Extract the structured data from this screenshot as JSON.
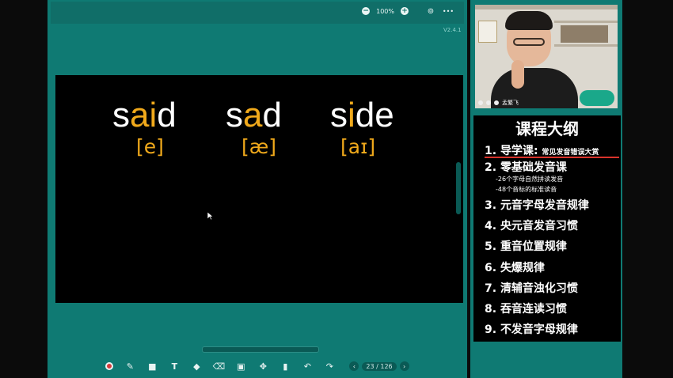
{
  "topbar": {
    "zoom": "100%",
    "zoom_out": "−",
    "zoom_in": "+",
    "settings_glyph": "⊚",
    "more_glyph": "•••"
  },
  "version": "V2.4.1",
  "slide": {
    "words": [
      {
        "pre": "s",
        "hl": "ai",
        "post": "d",
        "ipa": "[e]"
      },
      {
        "pre": "s",
        "hl": "a",
        "post": "d",
        "ipa": "[æ]"
      },
      {
        "pre": "s",
        "hl": "i",
        "post": "de",
        "ipa": "[aɪ]"
      }
    ],
    "highlight_color": "#f0a91b"
  },
  "toolbar": {
    "tools": [
      {
        "name": "record-icon"
      },
      {
        "name": "pen-icon",
        "glyph": "✎"
      },
      {
        "name": "rectangle-icon",
        "glyph": "■"
      },
      {
        "name": "text-icon",
        "glyph": "T"
      },
      {
        "name": "bucket-icon",
        "glyph": "◆"
      },
      {
        "name": "eraser-icon",
        "glyph": "⌫"
      },
      {
        "name": "save-icon",
        "glyph": "▣"
      },
      {
        "name": "move-icon",
        "glyph": "✥"
      },
      {
        "name": "trash-icon",
        "glyph": "▮"
      },
      {
        "name": "undo-icon",
        "glyph": "↶"
      },
      {
        "name": "redo-icon",
        "glyph": "↷"
      }
    ],
    "page_current": "23",
    "page_total": "/ 126",
    "prev": "‹",
    "next": "›"
  },
  "video": {
    "name": "孟繁飞"
  },
  "outline": {
    "title": "课程大纲",
    "items": [
      {
        "num": "1.",
        "label": "导学课",
        "colon": ":",
        "sub": "常见发音错误大赏",
        "color": "#f0a91b"
      },
      {
        "num": "2.",
        "label": "零基础发音课"
      },
      {
        "num": "3.",
        "label": "元音字母发音规律"
      },
      {
        "num": "4.",
        "label": "央元音发音习惯"
      },
      {
        "num": "5.",
        "label": "重音位置规律"
      },
      {
        "num": "6.",
        "label": "失爆规律"
      },
      {
        "num": "7.",
        "label": "清辅音浊化习惯"
      },
      {
        "num": "8.",
        "label": "吞音连读习惯"
      },
      {
        "num": "9.",
        "label": "不发音字母规律"
      }
    ],
    "subs": [
      "-26个字母自然拼读发音",
      "-48个音标的标准读音"
    ],
    "accent": "#d9332b"
  }
}
